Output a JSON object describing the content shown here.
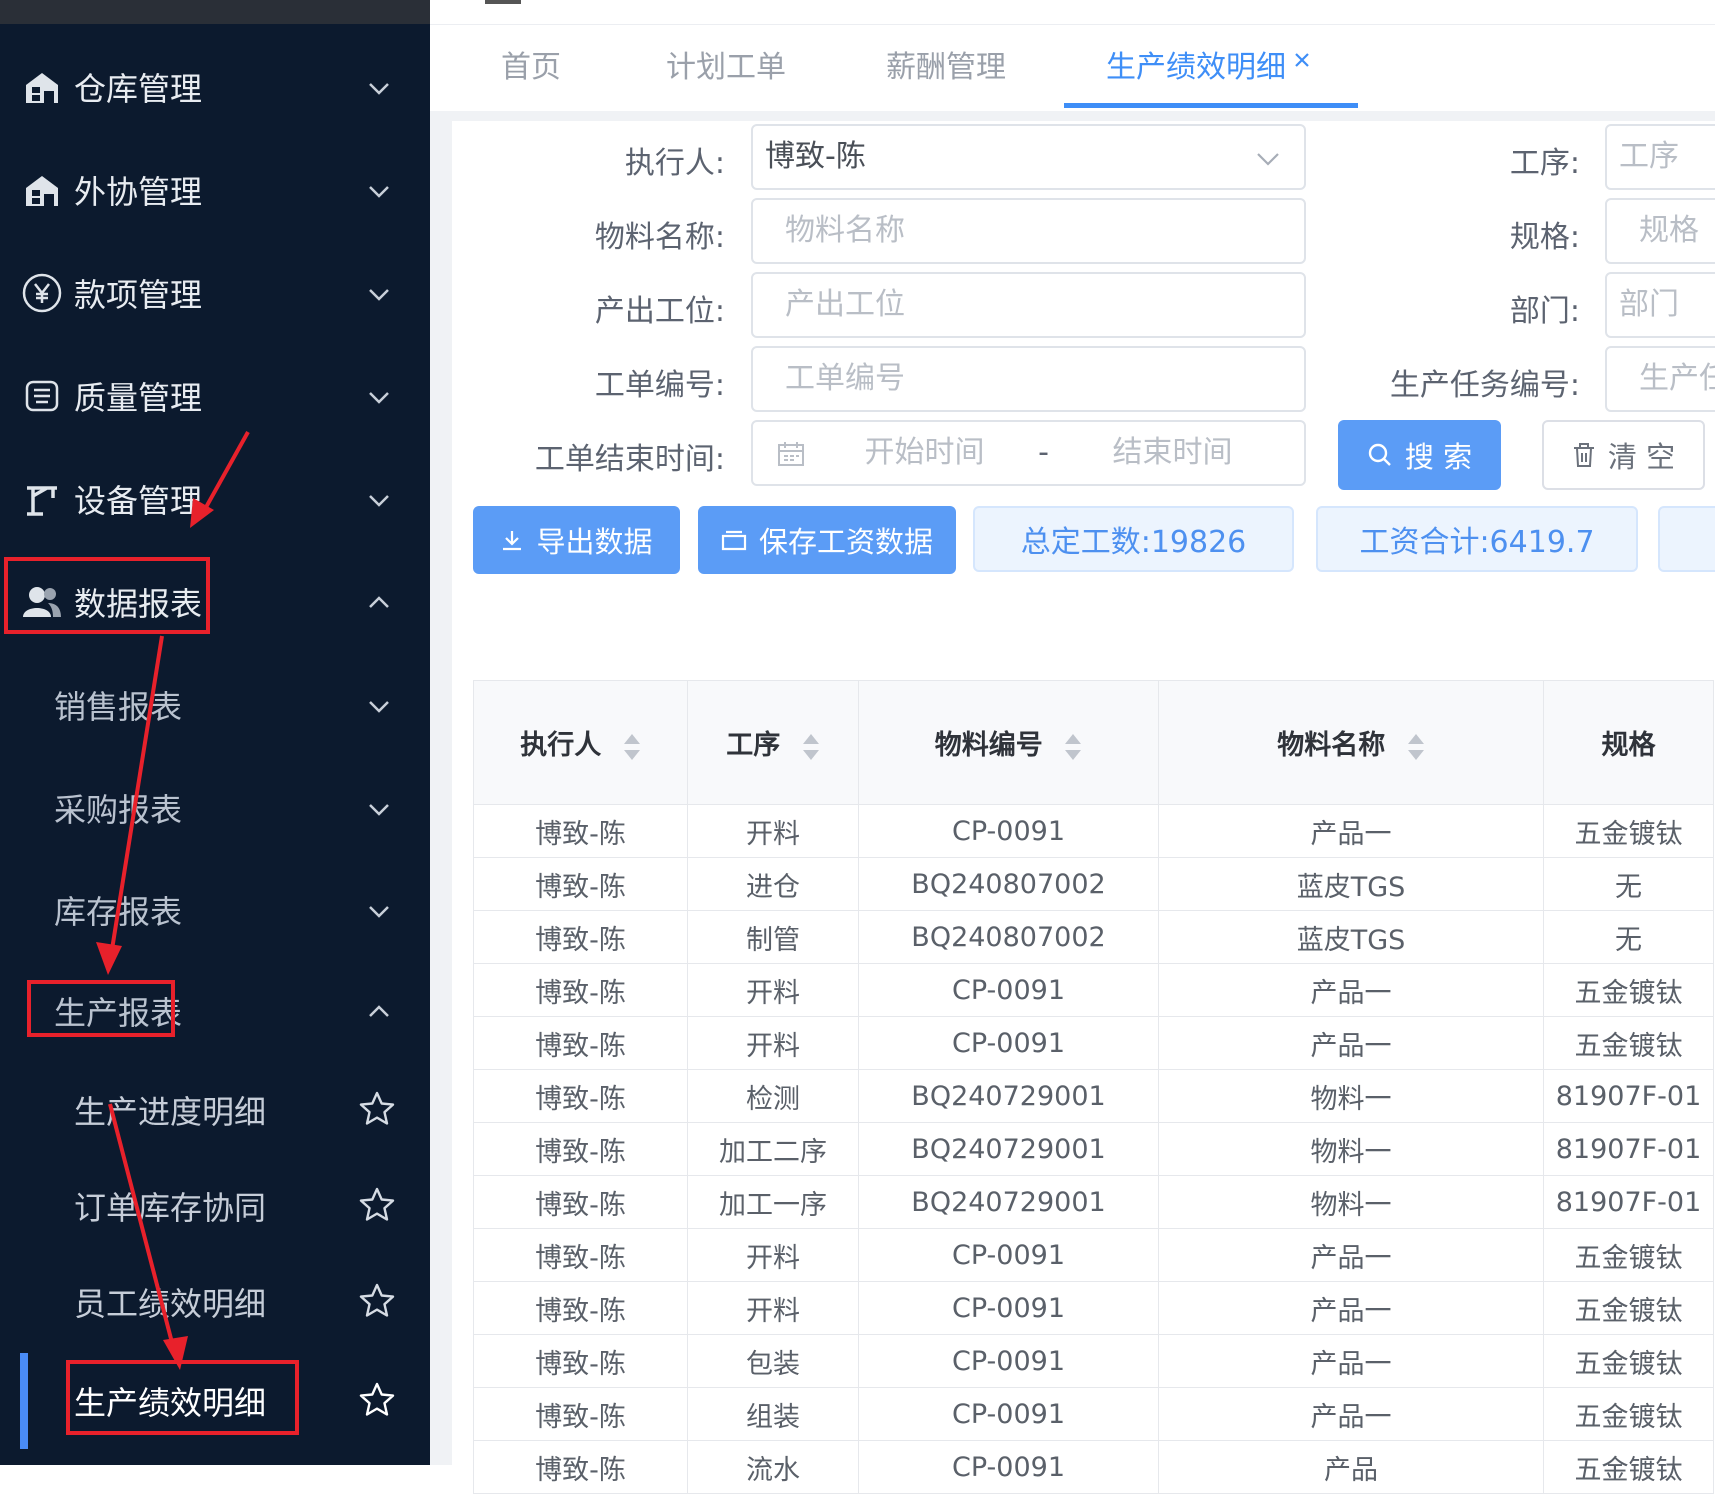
{
  "sidebar": {
    "items": [
      {
        "label": "仓库管理",
        "icon": "building-icon",
        "expanded": false
      },
      {
        "label": "外协管理",
        "icon": "building-icon",
        "expanded": false
      },
      {
        "label": "款项管理",
        "icon": "yen-circle-icon",
        "expanded": false
      },
      {
        "label": "质量管理",
        "icon": "quality-icon",
        "expanded": false
      },
      {
        "label": "设备管理",
        "icon": "crane-icon",
        "expanded": false
      },
      {
        "label": "数据报表",
        "icon": "users-icon",
        "expanded": true
      }
    ],
    "sub_items": [
      {
        "label": "销售报表",
        "expanded": false
      },
      {
        "label": "采购报表",
        "expanded": false
      },
      {
        "label": "库存报表",
        "expanded": false
      },
      {
        "label": "生产报表",
        "expanded": true
      }
    ],
    "leaf_items": [
      {
        "label": "生产进度明细",
        "active": false
      },
      {
        "label": "订单库存协同",
        "active": false
      },
      {
        "label": "员工绩效明细",
        "active": false
      },
      {
        "label": "生产绩效明细",
        "active": true
      }
    ]
  },
  "tabs": [
    {
      "label": "首页",
      "active": false
    },
    {
      "label": "计划工单",
      "active": false
    },
    {
      "label": "薪酬管理",
      "active": false
    },
    {
      "label": "生产绩效明细",
      "active": true
    }
  ],
  "filters": {
    "executor": {
      "label": "执行人:",
      "value": "博致-陈"
    },
    "material_name": {
      "label": "物料名称:",
      "placeholder": "物料名称"
    },
    "output_station": {
      "label": "产出工位:",
      "placeholder": "产出工位"
    },
    "order_no": {
      "label": "工单编号:",
      "placeholder": "工单编号"
    },
    "end_time": {
      "label": "工单结束时间:",
      "start_placeholder": "开始时间",
      "separator": "-",
      "end_placeholder": "结束时间"
    },
    "process": {
      "label": "工序:",
      "placeholder": "工序"
    },
    "spec": {
      "label": "规格:",
      "placeholder": "规格"
    },
    "dept": {
      "label": "部门:",
      "placeholder": "部门"
    },
    "task_no": {
      "label": "生产任务编号:",
      "placeholder": "生产任"
    }
  },
  "actions": {
    "search": "搜 索",
    "clear": "清 空",
    "export": "导出数据",
    "save_wage": "保存工资数据",
    "total_hours": "总定工数:19826",
    "total_wage": "工资合计:6419.7"
  },
  "table": {
    "columns": [
      "执行人",
      "工序",
      "物料编号",
      "物料名称",
      "规格"
    ],
    "rows": [
      [
        "博致-陈",
        "开料",
        "CP-0091",
        "产品一",
        "五金镀钛"
      ],
      [
        "博致-陈",
        "进仓",
        "BQ240807002",
        "蓝皮TGS",
        "无"
      ],
      [
        "博致-陈",
        "制管",
        "BQ240807002",
        "蓝皮TGS",
        "无"
      ],
      [
        "博致-陈",
        "开料",
        "CP-0091",
        "产品一",
        "五金镀钛"
      ],
      [
        "博致-陈",
        "开料",
        "CP-0091",
        "产品一",
        "五金镀钛"
      ],
      [
        "博致-陈",
        "检测",
        "BQ240729001",
        "物料一",
        "81907F-01"
      ],
      [
        "博致-陈",
        "加工二序",
        "BQ240729001",
        "物料一",
        "81907F-01"
      ],
      [
        "博致-陈",
        "加工一序",
        "BQ240729001",
        "物料一",
        "81907F-01"
      ],
      [
        "博致-陈",
        "开料",
        "CP-0091",
        "产品一",
        "五金镀钛"
      ],
      [
        "博致-陈",
        "开料",
        "CP-0091",
        "产品一",
        "五金镀钛"
      ],
      [
        "博致-陈",
        "包装",
        "CP-0091",
        "产品一",
        "五金镀钛"
      ],
      [
        "博致-陈",
        "组装",
        "CP-0091",
        "产品一",
        "五金镀钛"
      ],
      [
        "博致-陈",
        "流水",
        "CP-0091",
        "产品",
        "五金镀钛"
      ]
    ]
  },
  "colors": {
    "sidebar_bg": "#0c1a2e",
    "accent": "#3e8ef7",
    "annotation": "#e8212b"
  }
}
